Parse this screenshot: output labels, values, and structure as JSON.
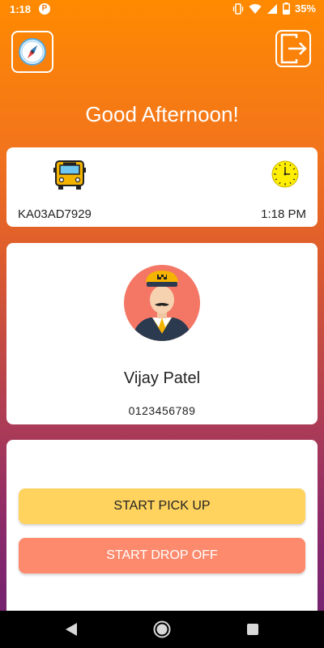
{
  "status_bar": {
    "time": "1:18",
    "notification_letter": "P",
    "battery_percent": "35%"
  },
  "header": {
    "greeting": "Good Afternoon!"
  },
  "bus_card": {
    "bus_number": "KA03AD7929",
    "current_time": "1:18 PM"
  },
  "driver_card": {
    "name": "Vijay Patel",
    "phone": "0123456789"
  },
  "actions": {
    "start_pickup_label": "START PICK UP",
    "start_dropoff_label": "START DROP OFF"
  },
  "colors": {
    "pickup_button": "#ffd35e",
    "dropoff_button": "#fd8a6d",
    "gradient_top": "#ff8a00",
    "gradient_bottom": "#6c1f73"
  },
  "icons": [
    "compass-icon",
    "logout-icon",
    "bus-icon",
    "clock-icon",
    "driver-avatar",
    "nav-back-icon",
    "nav-home-icon",
    "nav-recent-icon"
  ]
}
